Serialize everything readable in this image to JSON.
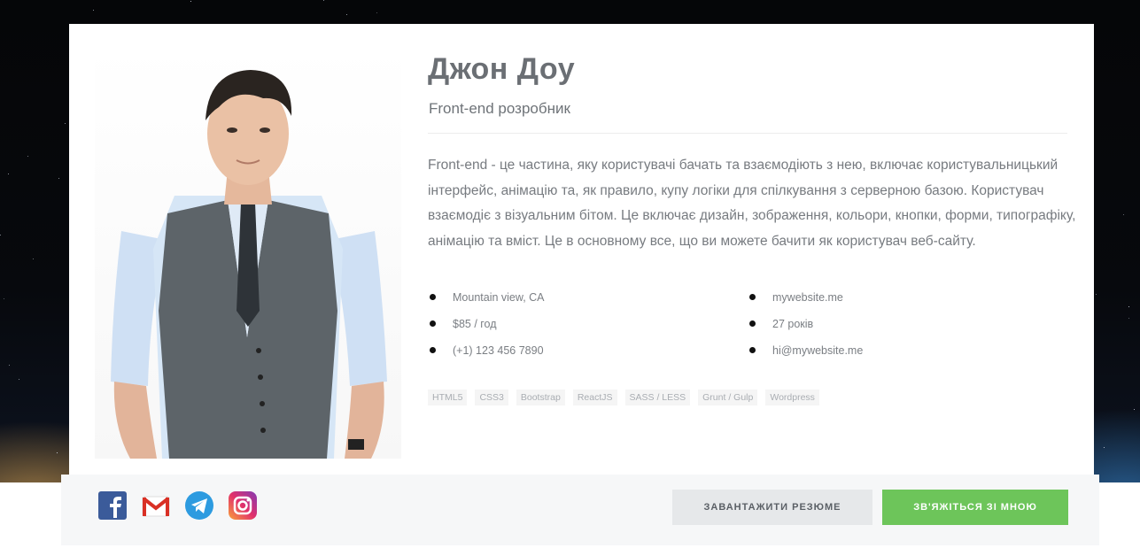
{
  "profile": {
    "name": "Джон Доу",
    "title": "Front-end розробник",
    "bio": "Front-end - це частина, яку користувачі бачать та взаємодіють з нею, включає користувальницький інтерфейс, анімацію та, як правило, купу логіки для спілкування з серверною базою. Користувач взаємодіє з візуальним бітом. Це включає дизайн, зображення, кольори, кнопки, форми, типографіку, анімацію та вміст. Це в основному все, що ви можете бачити як користувач веб-сайту."
  },
  "info_left": [
    "Mountain view, CA",
    "$85 / год",
    "(+1) 123 456 7890"
  ],
  "info_right": [
    "mywebsite.me",
    "27 років",
    "hi@mywebsite.me"
  ],
  "skills": [
    "HTML5",
    "CSS3",
    "Bootstrap",
    "ReactJS",
    "SASS / LESS",
    "Grunt / Gulp",
    "Wordpress"
  ],
  "social": [
    {
      "icon": "facebook-icon"
    },
    {
      "icon": "gmail-icon"
    },
    {
      "icon": "telegram-icon"
    },
    {
      "icon": "instagram-icon"
    }
  ],
  "actions": {
    "download_cv": "ЗАВАНТАЖИТИ РЕЗЮМЕ",
    "contact": "ЗВ'ЯЖІТЬСЯ ЗІ МНОЮ"
  },
  "colors": {
    "accent_green": "#6dc55a",
    "text_grey": "#777b80",
    "button_grey": "#e6e8ea"
  }
}
